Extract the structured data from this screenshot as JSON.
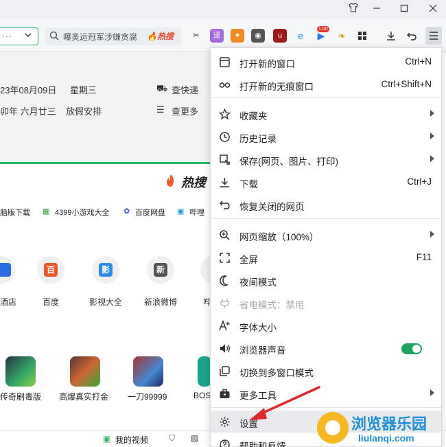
{
  "toolbar": {
    "search_placeholder": "曝奥运冠军涉嫌贪腐",
    "hot_search_badge": "热搜",
    "badge_count": "1.00"
  },
  "page": {
    "calendar": {
      "date": "23年08月09日",
      "weekday": "星期三",
      "lunar": "卯年 六月廿三",
      "holiday": "放假安排",
      "check_express": "查快递",
      "more": "查更多"
    },
    "hot_label": "热搜",
    "links": [
      "脑版下载",
      "4399小游戏大全",
      "百度网盘",
      "哔哩"
    ],
    "tiles": [
      {
        "label": "酒店",
        "glyph": ""
      },
      {
        "label": "百度",
        "glyph": "百"
      },
      {
        "label": "影视大全",
        "glyph": "影"
      },
      {
        "label": "新浪微博",
        "glyph": "新"
      },
      {
        "label": "哔",
        "glyph": ""
      }
    ],
    "games": [
      "传奇刷毒版",
      "高爆真实打金",
      "一刀99999",
      "BOS"
    ],
    "bottom": {
      "videos": "我的视频"
    }
  },
  "menu": {
    "items": [
      {
        "label": "打开新的窗口",
        "shortcut": "Ctrl+N",
        "icon": "window-icon"
      },
      {
        "label": "打开新的无痕窗口",
        "shortcut": "Ctrl+Shift+N",
        "icon": "incognito-icon"
      },
      {
        "label": "收藏夹",
        "icon": "star-icon"
      },
      {
        "label": "历史记录",
        "icon": "clock-icon"
      },
      {
        "label": "保存(网页、图片、打印)",
        "icon": "save-icon"
      },
      {
        "label": "下载",
        "shortcut": "Ctrl+J",
        "icon": "download-icon"
      },
      {
        "label": "恢复关闭的网页",
        "icon": "undo-icon"
      },
      {
        "label": "网页缩放（100%）",
        "icon": "zoom-icon"
      },
      {
        "label": "全屏",
        "shortcut": "F11",
        "icon": "fullscreen-icon"
      },
      {
        "label": "夜间模式",
        "icon": "moon-icon"
      },
      {
        "label": "省电模式：禁用",
        "icon": "power-saving-icon"
      },
      {
        "label": "字体大小",
        "icon": "font-size-icon"
      },
      {
        "label": "浏览器声音",
        "icon": "speaker-icon"
      },
      {
        "label": "切换到多窗口模式",
        "icon": "multiwindow-icon"
      },
      {
        "label": "更多工具",
        "icon": "toolbox-icon"
      },
      {
        "label": "设置",
        "icon": "gear-icon"
      },
      {
        "label": "帮助和反馈",
        "icon": "help-icon"
      }
    ]
  },
  "watermark": {
    "title": "浏览器乐园",
    "url": "liulanqi.com"
  },
  "colors": {
    "accent_green": "#2fb866",
    "toggle_on": "#1ea45c",
    "arrow_red": "#e0282c",
    "watermark_blue": "#1e90d8"
  }
}
